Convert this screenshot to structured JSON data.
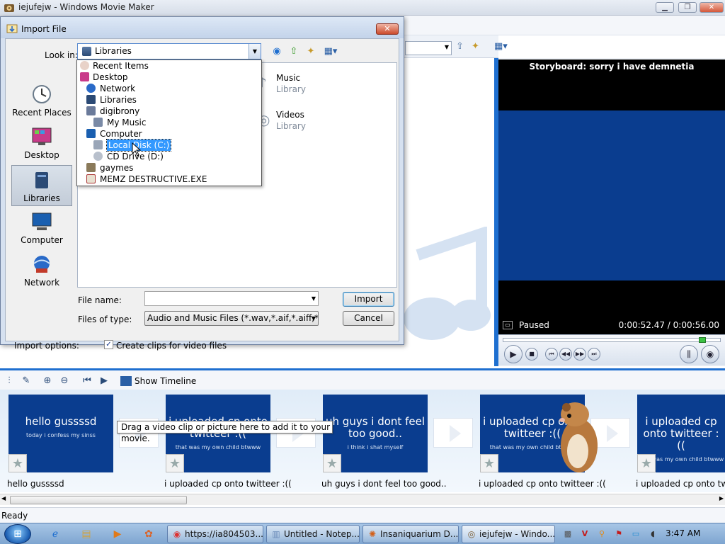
{
  "main_window": {
    "title": "iejufejw - Windows Movie Maker",
    "min": "▁",
    "max": "❐",
    "close": "✕"
  },
  "monitor": {
    "title": "Storyboard: sorry i have demnetia",
    "status": "Paused",
    "time": "0:00:52.47 / 0:00:56.00"
  },
  "storyboard_toolbar": {
    "show_timeline": "Show Timeline"
  },
  "storyboard": {
    "tooltip": "Drag a video clip or picture here to add it to your movie.",
    "clips": [
      {
        "title": "hello gussssd",
        "sub": "today i confess my sinss",
        "label": "hello gussssd"
      },
      {
        "title": "i uploaded cp onto twitteer :((",
        "sub": "that was my own child btwww",
        "label": "i uploaded cp onto twitteer :(("
      },
      {
        "title": "uh guys i dont feel too good..",
        "sub": "i think i shat myself",
        "label": "uh guys i dont feel too good.."
      },
      {
        "title": "i uploaded cp onto twitteer :((",
        "sub": "that was my own child btwww",
        "label": "i uploaded cp onto twitteer :(("
      },
      {
        "title": "i uploaded cp onto twitteer :((",
        "sub": "that was my own child btwww",
        "label": "i uploaded cp onto twitteer"
      }
    ]
  },
  "status_bar": {
    "text": "Ready"
  },
  "dialog": {
    "title": "Import File",
    "close": "✕",
    "look_in_label": "Look in:",
    "look_in_value": "Libraries",
    "places": [
      {
        "label": "Recent Places"
      },
      {
        "label": "Desktop"
      },
      {
        "label": "Libraries"
      },
      {
        "label": "Computer"
      },
      {
        "label": "Network"
      }
    ],
    "dropdown_items": [
      "Recent Items",
      "Desktop",
      "Network",
      "Libraries",
      "digibrony",
      "My Music",
      "Computer",
      "Local Disk (C:)",
      "CD Drive (D:)",
      "gaymes",
      "MEMZ DESTRUCTIVE.EXE"
    ],
    "files": [
      {
        "name": "Music",
        "type": "Library"
      },
      {
        "name": "Videos",
        "type": "Library"
      }
    ],
    "file_name_label": "File name:",
    "file_name_value": "",
    "files_of_type_label": "Files of type:",
    "files_of_type_value": "Audio and Music Files (*.wav,*.aif,*.aiff,*.aifc,*.s",
    "import_button": "Import",
    "cancel_button": "Cancel",
    "import_options_label": "Import options:",
    "create_clips_label": "Create clips for video files",
    "create_clips_checked": "✓"
  },
  "taskbar": {
    "start": "⊞",
    "buttons": [
      {
        "label": "https://ia804503...."
      },
      {
        "label": "Untitled - Notep..."
      },
      {
        "label": "Insaniquarium D..."
      },
      {
        "label": "iejufejw - Windo..."
      }
    ],
    "clock": "3:47 AM"
  },
  "colors": {
    "accent": "#1e6fd0",
    "clip_bg": "#0a3d8f",
    "selection": "#3399ff"
  }
}
